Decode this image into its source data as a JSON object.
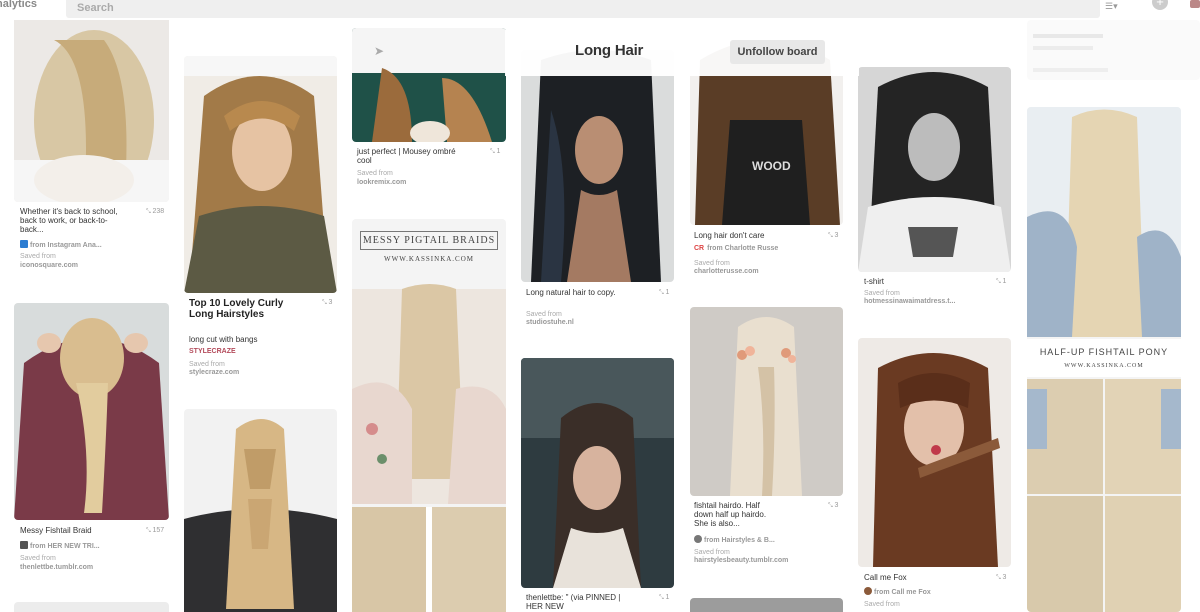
{
  "app": {
    "brand": "nalytics"
  },
  "search": {
    "placeholder": "Search",
    "value": ""
  },
  "board": {
    "title": "Long Hair",
    "unfollow_label": "Unfollow board"
  },
  "icons": {
    "grid": "list-view-icon",
    "add": "plus-icon",
    "send": "send-icon"
  },
  "colors": {
    "header_bg": "#ffffff",
    "search_bg": "#efefef",
    "button_bg": "#e8e8e8",
    "cr_red": "#d44"
  },
  "pins": {
    "p1": {
      "desc": "Whether it's back to school, back to work, or back-to-back...",
      "repins": "238",
      "source": "from Instagram Ana...",
      "saved_label": "Saved from",
      "saved_from": "iconosquare.com"
    },
    "p2": {
      "desc": "Messy Fishtail Braid",
      "repins": "157",
      "source": "from HER NEW TRI...",
      "saved_label": "Saved from",
      "saved_from": "thenlettbe.tumblr.com"
    },
    "p3": {
      "title": "Top 10 Lovely Curly Long Hairstyles",
      "desc": "long cut with bangs",
      "brand": "STYLECRAZE",
      "repins": "3",
      "saved_label": "Saved from",
      "saved_from": "stylecraze.com"
    },
    "p4": {
      "desc": "just perfect | Mousey ombré cool",
      "repins": "1",
      "saved_label": "Saved from",
      "saved_from": "lookremix.com"
    },
    "p5": {
      "overlay_title": "MESSY PIGTAIL BRAIDS",
      "overlay_site": "WWW.KASSINKA.COM"
    },
    "p6": {
      "desc": "Long natural hair to copy.",
      "repins": "1",
      "saved_label": "Saved from",
      "saved_from": "studiostuhe.nl"
    },
    "p7": {
      "desc": "thenlettbe: \" (via PINNED | HER NEW",
      "repins": "1"
    },
    "p8": {
      "desc": "Long hair don't care",
      "repins": "3",
      "badge": "CR",
      "source": "from Charlotte Russe",
      "saved_label": "Saved from",
      "saved_from": "charlotterusse.com"
    },
    "p9": {
      "desc": "fishtail hairdo. Half down half up hairdo. She is also...",
      "repins": "3",
      "source": "from Hairstyles & B...",
      "saved_label": "Saved from",
      "saved_from": "hairstylesbeauty.tumblr.com"
    },
    "p10": {
      "desc": "t-shirt",
      "repins": "1",
      "saved_label": "Saved from",
      "saved_from": "hotmessinawaimatdress.t..."
    },
    "p11": {
      "desc": "Call me Fox",
      "repins": "3",
      "source": "from Call me Fox",
      "saved_label": "Saved from"
    },
    "p12": {
      "overlay_title": "HALF-UP FISHTAIL PONY",
      "overlay_site": "WWW.KASSINKA.COM"
    }
  }
}
